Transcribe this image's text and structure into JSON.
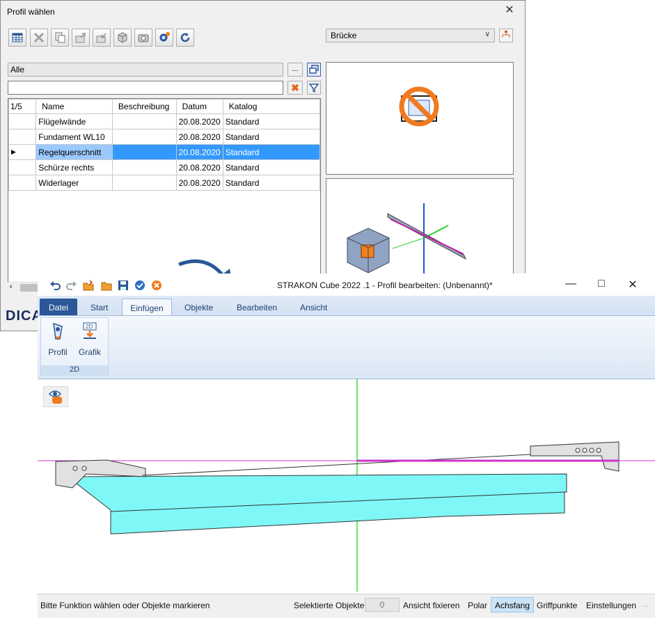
{
  "dialog": {
    "title": "Profil wählen",
    "close": "✕",
    "category_select": "Brücke",
    "filter_path": "Alle",
    "dots": "...",
    "clear": "✖",
    "grid": {
      "counter": "1/5",
      "columns": [
        "Name",
        "Beschreibung",
        "Datum",
        "Katalog"
      ],
      "rows": [
        {
          "name": "Flügelwände",
          "desc": "",
          "date": "20.08.2020",
          "catalog": "Standard"
        },
        {
          "name": "Fundament WL10",
          "desc": "",
          "date": "20.08.2020",
          "catalog": "Standard"
        },
        {
          "name": "Regelquerschnitt",
          "desc": "",
          "date": "20.08.2020",
          "catalog": "Standard",
          "selected": true
        },
        {
          "name": "Schürze rechts",
          "desc": "",
          "date": "20.08.2020",
          "catalog": "Standard"
        },
        {
          "name": "Widerlager",
          "desc": "",
          "date": "20.08.2020",
          "catalog": "Standard"
        }
      ]
    },
    "logo": "DICA"
  },
  "main": {
    "title": "STRAKON Cube 2022 .1 - Profil bearbeiten: (Unbenannt)*",
    "tabs": [
      "Datei",
      "Start",
      "Einfügen",
      "Objekte",
      "Bearbeiten",
      "Ansicht"
    ],
    "active_tab": "Einfügen",
    "group": {
      "label": "2D",
      "buttons": [
        {
          "label": "Profil",
          "icon": "profile-icon"
        },
        {
          "label": "Grafik",
          "icon": "graphic-2d-icon",
          "badge": "2D"
        }
      ]
    },
    "status": {
      "message": "Bitte Funktion wählen oder Objekte markieren",
      "selected_label": "Selektierte Objekte",
      "selected_count": "0",
      "items": [
        "Ansicht fixieren",
        "Polar",
        "Achsfang",
        "Griffpunkte",
        "Einstellungen"
      ],
      "active_item": "Achsfang"
    }
  },
  "colors": {
    "accent": "#2b5797",
    "selection": "#3399ff",
    "profile_fill": "#7ff7f6",
    "axis_green": "#3fdc3f",
    "axis_magenta": "#cc33cc"
  }
}
